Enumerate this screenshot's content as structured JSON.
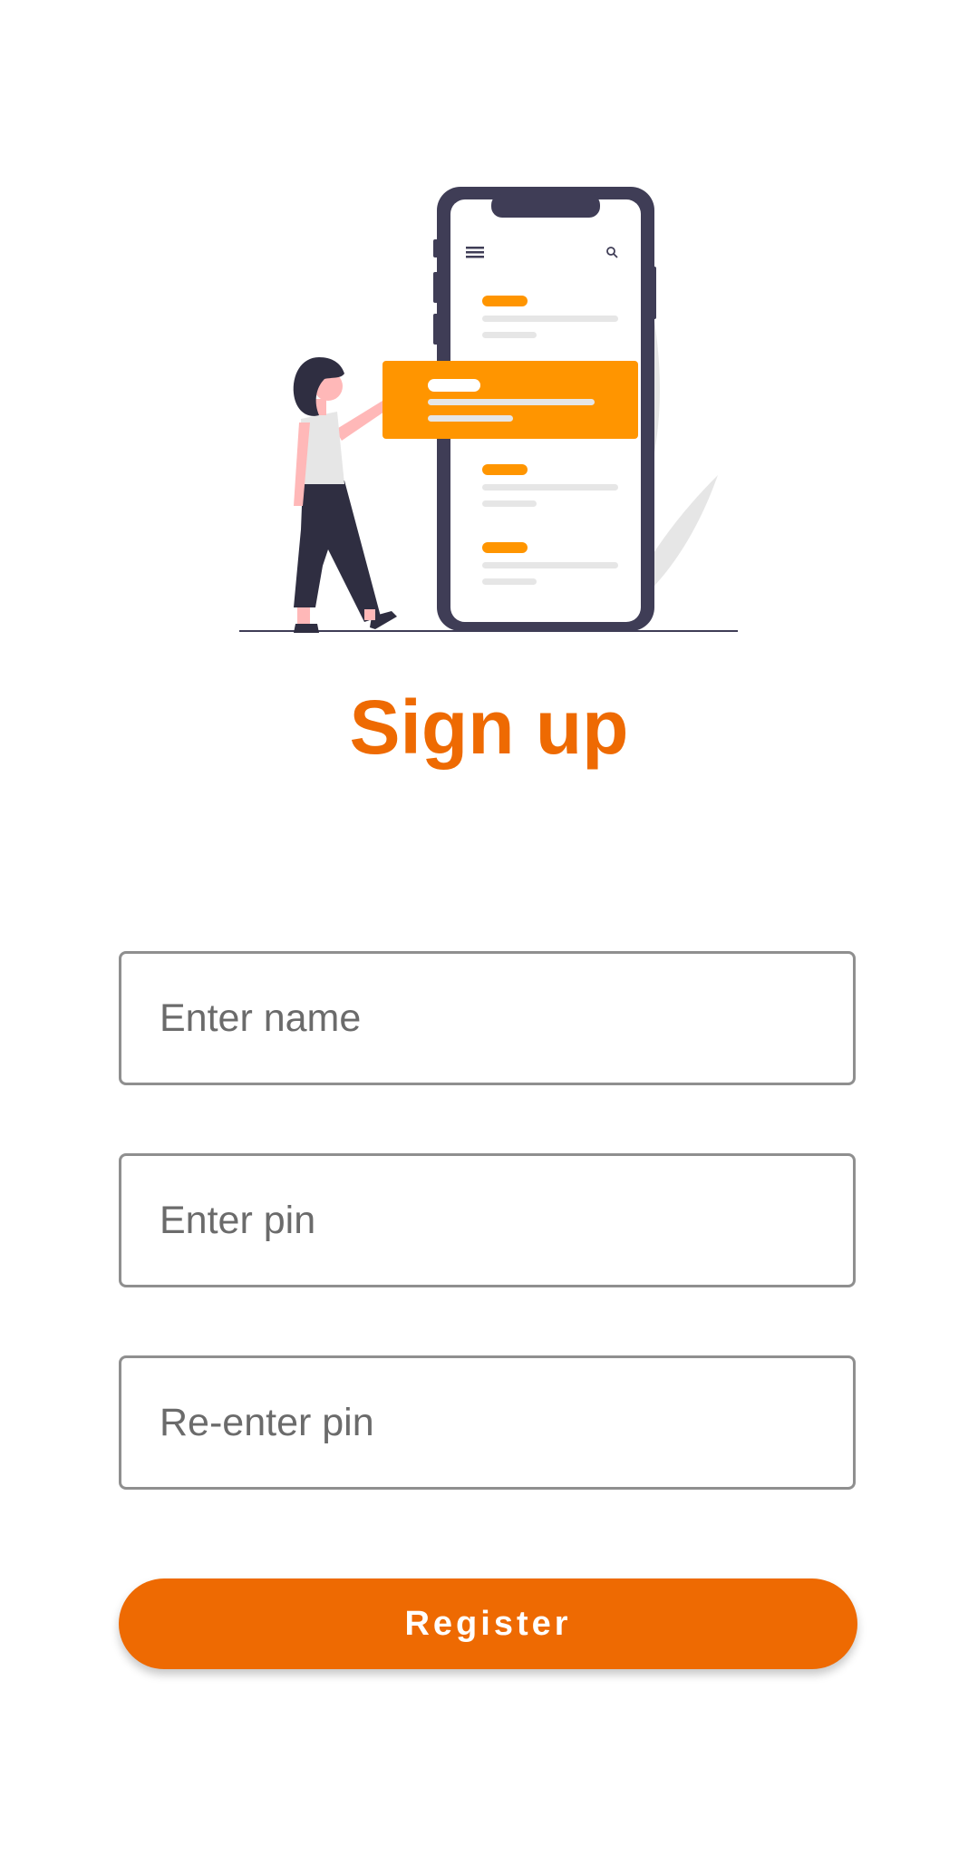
{
  "header": {
    "title": "Sign up"
  },
  "form": {
    "name_placeholder": "Enter name",
    "name_value": "",
    "pin_placeholder": "Enter pin",
    "pin_value": "",
    "repin_placeholder": "Re-enter pin",
    "repin_value": "",
    "register_label": "Register"
  },
  "illustration": {
    "name": "person-with-phone-illustration"
  },
  "colors": {
    "accent": "#EE6A02",
    "illustration_orange": "#FF9500",
    "phone_frame": "#3F3D56",
    "field_border": "#8F8F8F",
    "placeholder_text": "#6B6B6B",
    "background": "#FFFFFF"
  }
}
